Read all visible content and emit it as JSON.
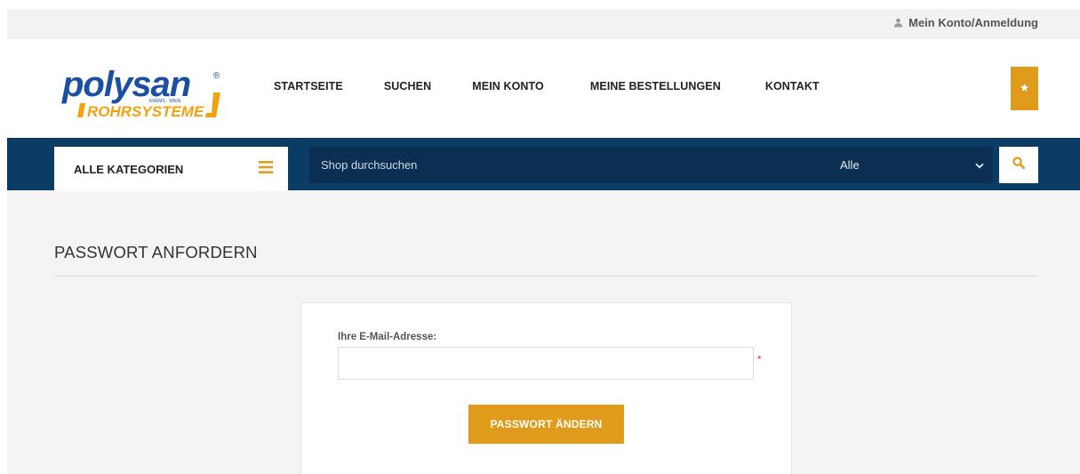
{
  "topbar": {
    "account_label": "Mein Konto/Anmeldung",
    "account_icon": "user-icon"
  },
  "logo": {
    "brand": "polysan",
    "tagline": "KREMS · WIEN",
    "subtitle": "ROHRSYSTEME",
    "registered": "®"
  },
  "nav": {
    "items": [
      {
        "label": "STARTSEITE"
      },
      {
        "label": "SUCHEN"
      },
      {
        "label": "MEIN KONTO"
      },
      {
        "label": "MEINE BESTELLUNGEN"
      },
      {
        "label": "KONTAKT"
      }
    ]
  },
  "wishlist": {
    "icon": "star-icon"
  },
  "search": {
    "categories_label": "ALLE KATEGORIEN",
    "categories_icon": "hamburger-menu-icon",
    "placeholder": "Shop durchsuchen",
    "scope_selected": "Alle",
    "scope_icon": "chevron-down-icon",
    "button_icon": "search-icon"
  },
  "main": {
    "title": "PASSWORT ANFORDERN",
    "form": {
      "email_label": "Ihre E-Mail-Adresse:",
      "email_value": "",
      "required_mark": "*",
      "submit_label": "PASSWORT ÄNDERN"
    }
  },
  "colors": {
    "accent": "#e09b1b",
    "navy": "#0b3c66",
    "navy_dark": "#0a2f52",
    "logo_blue": "#1b4fa3",
    "required": "#e2393b"
  }
}
